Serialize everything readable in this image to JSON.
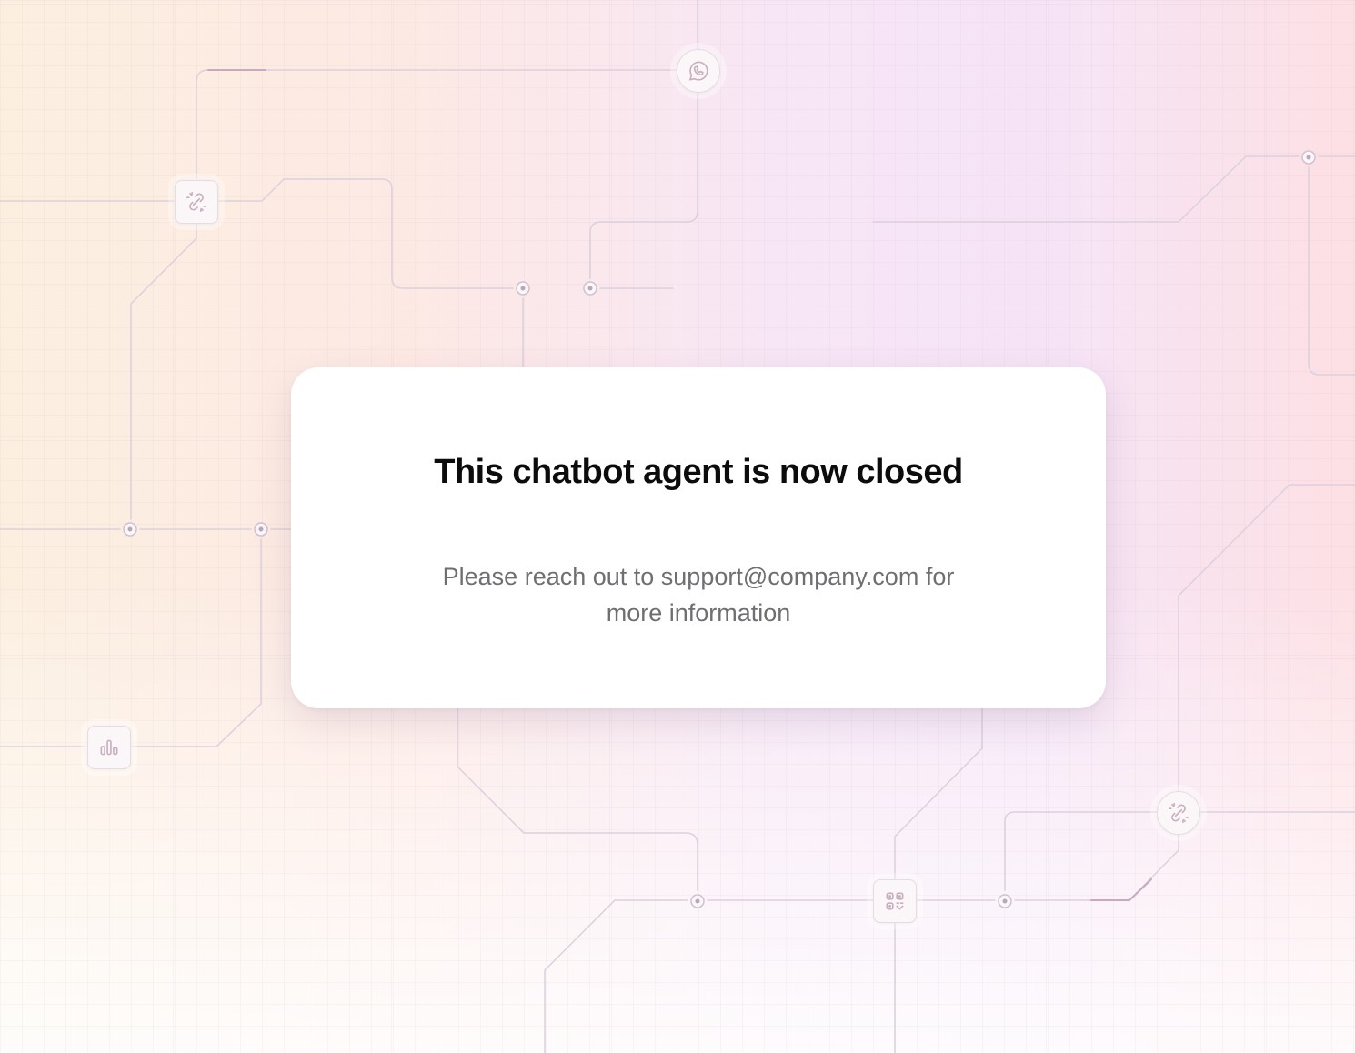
{
  "dialog": {
    "title": "This chatbot agent is now closed",
    "message": "Please reach out to support@company.com for more information"
  },
  "background": {
    "icons": [
      "link-icon",
      "phone-icon",
      "bar-chart-icon",
      "qr-code-icon",
      "link-icon"
    ],
    "colors": {
      "left": "#fcefe0",
      "middle": "#f7e6f6",
      "right": "#fde0e4",
      "card": "#ffffff",
      "title": "#0c0c0c",
      "message": "#6f6f73"
    }
  }
}
